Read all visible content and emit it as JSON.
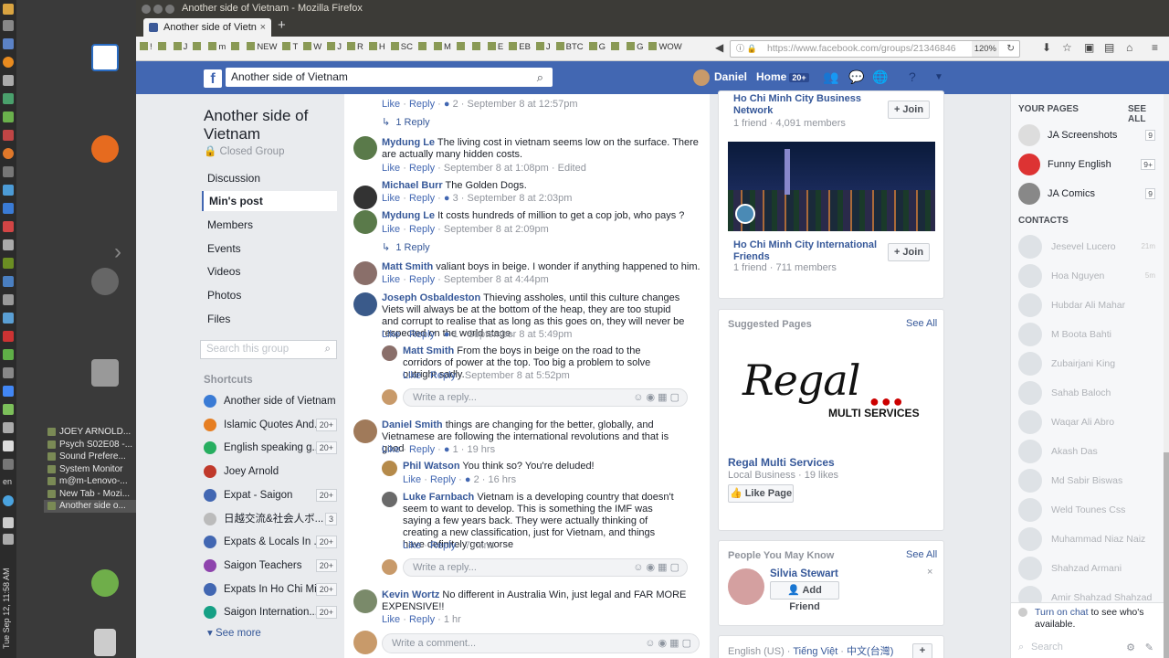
{
  "window": {
    "title": "Another side of Vietnam - Mozilla Firefox",
    "tab_label": "Another side of Vietn",
    "url": "https://www.facebook.com/groups/21346846",
    "zoom": "120%"
  },
  "bookmarks": [
    "!",
    "",
    "J",
    "",
    "m",
    "",
    "NEW",
    "T",
    "W",
    "J",
    "R",
    "H",
    "SC",
    "",
    "M",
    "",
    "",
    "E",
    "EB",
    "J",
    "BTC",
    "G",
    "",
    "G",
    "WOW"
  ],
  "desktop": {
    "clock": "Tue Sep 12, 11:58 AM",
    "lang": "en",
    "tasks": [
      "JOEY ARNOLD...",
      "Psych S02E08 -...",
      "Sound Prefere...",
      "System Monitor",
      "m@m-Lenovo-...",
      "New Tab - Mozi...",
      "Another side o..."
    ]
  },
  "fb": {
    "search_value": "Another side of Vietnam",
    "user": "Daniel",
    "home": "Home",
    "home_badge": "20+"
  },
  "group": {
    "title": "Another side of Vietnam",
    "privacy": "Closed Group",
    "nav": [
      "Discussion",
      "Min's post",
      "Members",
      "Events",
      "Videos",
      "Photos",
      "Files"
    ],
    "search_placeholder": "Search this group",
    "shortcuts_title": "Shortcuts",
    "shortcuts": [
      {
        "label": "Another side of Vietnam",
        "count": ""
      },
      {
        "label": "Islamic Quotes And...",
        "count": "20+"
      },
      {
        "label": "English speaking g...",
        "count": "20+"
      },
      {
        "label": "Joey Arnold",
        "count": ""
      },
      {
        "label": "Expat - Saigon",
        "count": "20+"
      },
      {
        "label": "日越交流&社会人ボ...",
        "count": "3"
      },
      {
        "label": "Expats & Locals In ...",
        "count": "20+"
      },
      {
        "label": "Saigon Teachers",
        "count": "20+"
      },
      {
        "label": "Expats In Ho Chi Mi...",
        "count": "20+"
      },
      {
        "label": "Saigon Internation...",
        "count": "20+"
      }
    ],
    "see_more": "See more"
  },
  "feed": {
    "top_meta": {
      "like": "Like",
      "reply": "Reply",
      "count": "2",
      "time": "September 8 at 12:57pm",
      "replies": "1 Reply"
    },
    "comments": [
      {
        "name": "Mydung Le",
        "text": "The living cost in vietnam seems low on the surface. There are actually many hidden costs.",
        "time": "September 8 at 1:08pm",
        "extra": "Edited",
        "count": ""
      },
      {
        "name": "Michael Burr",
        "text": "The Golden Dogs.",
        "time": "September 8 at 2:03pm",
        "count": "3"
      },
      {
        "name": "Mydung Le",
        "text": "It costs hundreds of million to get a cop job, who pays ?",
        "time": "September 8 at 2:09pm",
        "count": "",
        "replies": "1 Reply"
      },
      {
        "name": "Matt Smith",
        "text": "valiant boys in beige. I wonder if anything happened to him.",
        "time": "September 8 at 4:44pm",
        "count": ""
      },
      {
        "name": "Joseph Osbaldeston",
        "text": "Thieving assholes, until this culture changes Viets will always be at the bottom of the heap, they are too stupid and corrupt to realise that as long as this goes on, they will never be respected on the world stage.",
        "time": "September 8 at 5:49pm",
        "count": "1"
      },
      {
        "name": "Matt Smith",
        "text": "From the boys in beige on the road to the corridors of power at the top. Too big a problem to solve outright sadly.",
        "time": "September 8 at 5:52pm",
        "count": ""
      },
      {
        "name": "Daniel Smith",
        "text": "things are changing for the better, globally, and Vietnamese are following the international revolutions and that is good",
        "time": "19 hrs",
        "count": "1"
      },
      {
        "name": "Phil Watson",
        "text": "You think so? You're deluded!",
        "time": "16 hrs",
        "count": "2"
      },
      {
        "name": "Luke Farnbach",
        "text": "Vietnam is a developing country that doesn't seem to want to develop. This is something the IMF was saying a few years back. They were actually thinking of creating a new classification, just for Vietnam, and things have definitely got worse",
        "time": "7 mins",
        "count": ""
      },
      {
        "name": "Kevin Wortz",
        "text": "No different in Australia Win, just legal and FAR MORE EXPENSIVE!!",
        "time": "1 hr",
        "count": ""
      }
    ],
    "like": "Like",
    "reply": "Reply",
    "write_reply": "Write a reply...",
    "write_comment": "Write a comment..."
  },
  "right": {
    "groups": [
      {
        "name": "Ho Chi Minh City Business Network",
        "meta": "1 friend · 4,091 members",
        "join": "Join"
      },
      {
        "name": "Ho Chi Minh City International Friends",
        "meta": "1 friend · 711 members",
        "join": "Join"
      }
    ],
    "suggested_title": "Suggested Pages",
    "see_all": "See All",
    "logo_script": "Regal",
    "logo_sub": "MULTI SERVICES",
    "page_name": "Regal Multi Services",
    "page_meta": "Local Business · 19 likes",
    "like_page": "Like Page",
    "pymk_title": "People You May Know",
    "person": "Silvia Stewart",
    "add_friend": "Add Friend",
    "footer_langs": [
      "English (US)",
      "Tiếng Việt",
      "中文(台灣)"
    ]
  },
  "chat": {
    "pages_title": "YOUR PAGES",
    "see_all": "SEE ALL",
    "pages": [
      {
        "name": "JA Screenshots",
        "count": "9"
      },
      {
        "name": "Funny English",
        "count": "9+"
      },
      {
        "name": "JA Comics",
        "count": "9"
      }
    ],
    "contacts_title": "CONTACTS",
    "contacts": [
      {
        "name": "Jesevel Lucero",
        "meta": "21m"
      },
      {
        "name": "Hoa Nguyen",
        "meta": "5m"
      },
      {
        "name": "Hubdar Ali Mahar",
        "meta": ""
      },
      {
        "name": "M Boota Bahti",
        "meta": ""
      },
      {
        "name": "Zubairjani King",
        "meta": ""
      },
      {
        "name": "Sahab Baloch",
        "meta": ""
      },
      {
        "name": "Waqar Ali Abro",
        "meta": ""
      },
      {
        "name": "Akash Das",
        "meta": ""
      },
      {
        "name": "Md Sabir Biswas",
        "meta": ""
      },
      {
        "name": "Weld Tounes Css",
        "meta": ""
      },
      {
        "name": "Muhammad Niaz Naiz",
        "meta": ""
      },
      {
        "name": "Shahzad Armani",
        "meta": ""
      },
      {
        "name": "Amir Shahzad Shahzad",
        "meta": ""
      }
    ],
    "turn_on": "Turn on chat",
    "turn_on_rest": "to see who's available.",
    "search_placeholder": "Search"
  },
  "colors": {
    "fb_blue": "#4267b2",
    "link": "#365899"
  }
}
